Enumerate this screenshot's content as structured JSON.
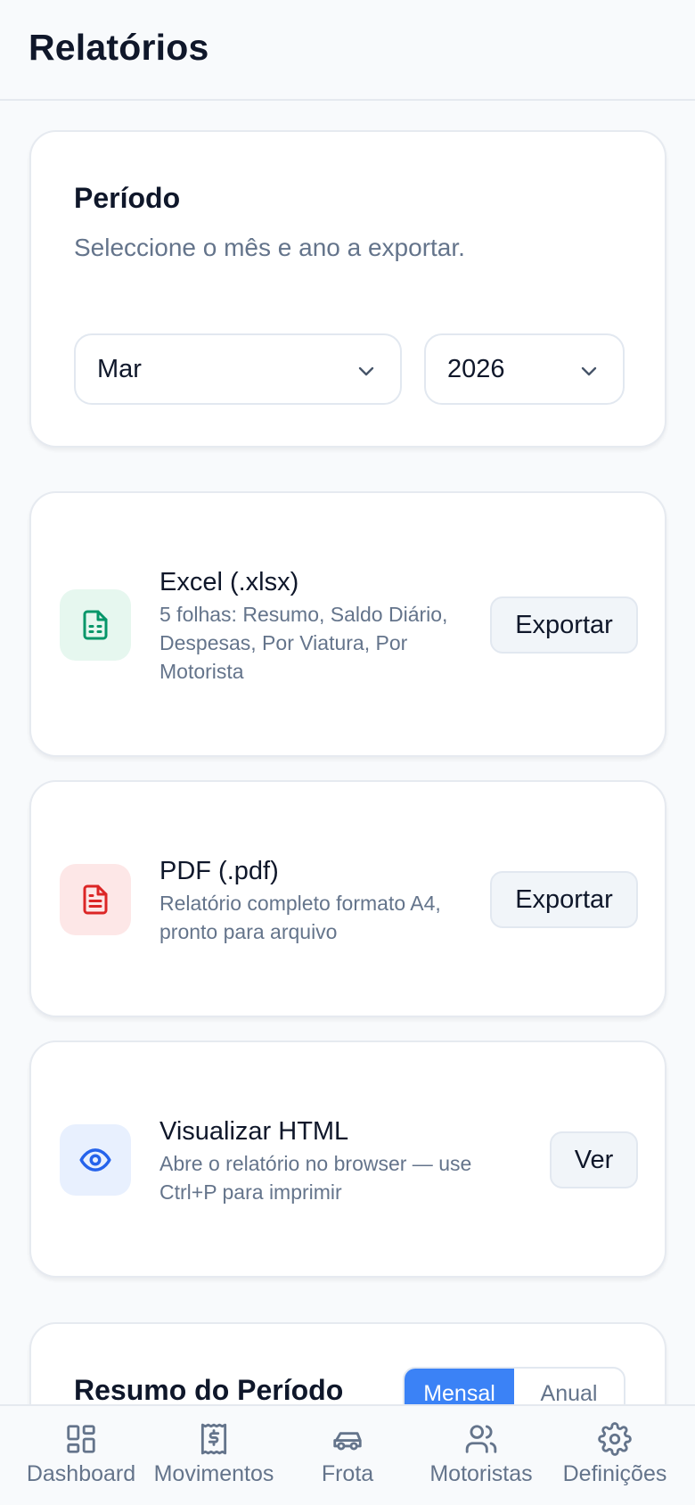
{
  "header": {
    "title": "Relatórios"
  },
  "period": {
    "title": "Período",
    "subtitle": "Seleccione o mês e ano a exportar.",
    "month": "Mar",
    "year": "2026"
  },
  "exports": {
    "excel": {
      "title": "Excel (.xlsx)",
      "description": "5 folhas: Resumo, Saldo Diário, Despesas, Por Viatura, Por Motorista",
      "button": "Exportar",
      "icon": "file-spreadsheet-icon",
      "color": "#059669"
    },
    "pdf": {
      "title": "PDF (.pdf)",
      "description": "Relatório completo formato A4, pronto para arquivo",
      "button": "Exportar",
      "icon": "file-text-icon",
      "color": "#dc2626"
    },
    "html": {
      "title": "Visualizar HTML",
      "description": "Abre o relatório no browser — use Ctrl+P para imprimir",
      "button": "Ver",
      "icon": "eye-icon",
      "color": "#2563eb"
    }
  },
  "summary": {
    "title": "Resumo do Período",
    "toggle": {
      "monthly": "Mensal",
      "annual": "Anual",
      "selected": "Mensal"
    }
  },
  "nav": {
    "dashboard": "Dashboard",
    "movements": "Movimentos",
    "fleet": "Frota",
    "drivers": "Motoristas",
    "settings": "Definições"
  },
  "colors": {
    "accent": "#3b82f6",
    "text": "#0f172a",
    "muted": "#64748b"
  }
}
